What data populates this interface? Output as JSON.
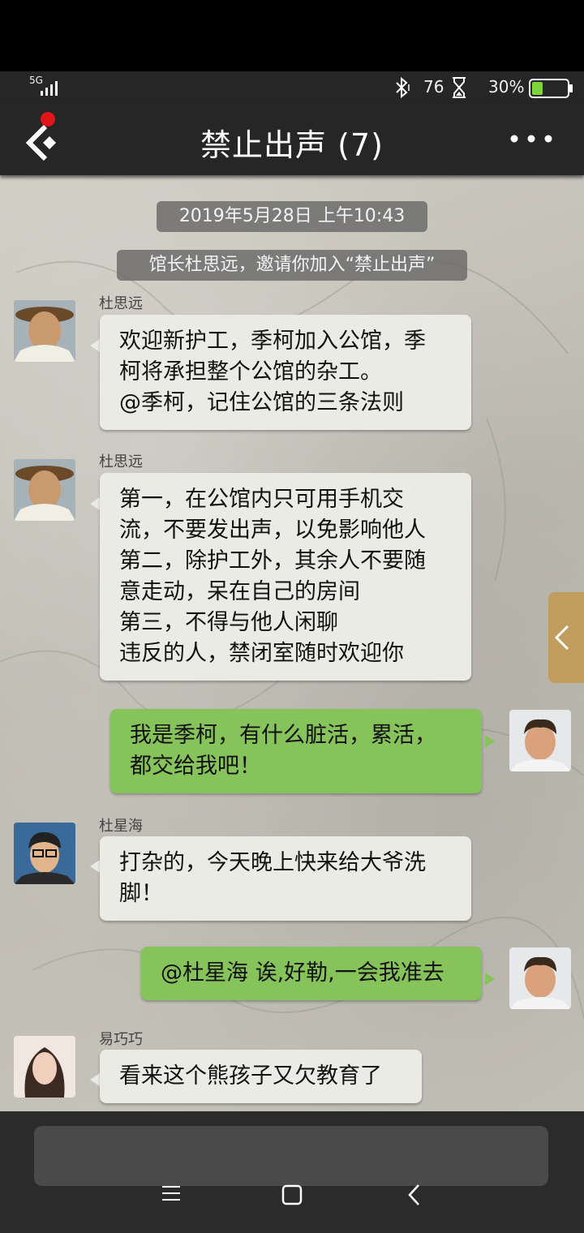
{
  "status": {
    "network": "5G",
    "speed": "76",
    "battery": "30%",
    "battery_level": 0.3
  },
  "header": {
    "title": "禁止出声 (7)",
    "back_has_notification": true,
    "more_icon": "more-dots-icon"
  },
  "system_messages": [
    "2019年5月28日 上午10:43",
    "馆长杜思远，邀请你加入“禁止出声”"
  ],
  "messages": [
    {
      "sender": "杜思远",
      "side": "left",
      "lines": [
        "欢迎新护工，季柯加入公馆，季",
        "柯将承担整个公馆的杂工。",
        "@季柯，记住公馆的三条法则"
      ]
    },
    {
      "sender": "杜思远",
      "side": "left",
      "lines": [
        "第一，在公馆内只可用手机交",
        "流，不要发出声，以免影响他人",
        "第二，除护工外，其余人不要随",
        "意走动，呆在自己的房间",
        "第三，不得与他人闲聊",
        "违反的人，禁闭室随时欢迎你"
      ]
    },
    {
      "sender": "",
      "side": "right",
      "lines": [
        "我是季柯，有什么脏活，累活，",
        "都交给我吧！"
      ]
    },
    {
      "sender": "杜星海",
      "side": "left",
      "lines": [
        "打杂的，今天晚上快来给大爷洗",
        "脚！"
      ]
    },
    {
      "sender": "",
      "side": "right",
      "lines": [
        "@杜星海 诶,好勒,一会我准去"
      ]
    },
    {
      "sender": "易巧巧",
      "side": "left",
      "lines": [
        "看来这个熊孩子又欠教育了"
      ]
    }
  ],
  "colors": {
    "bar": "#262626",
    "bubble_left": "#ebebe6",
    "bubble_right": "#86c35a",
    "side_tab": "#c49646"
  }
}
